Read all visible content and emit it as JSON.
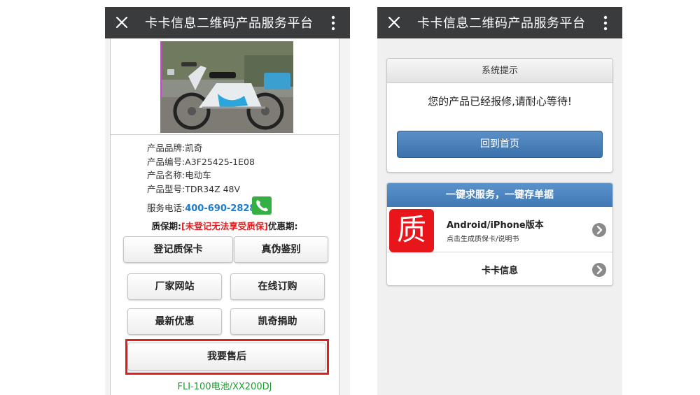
{
  "left_phone": {
    "titlebar": {
      "title": "卡卡信息二维码产品服务平台",
      "close_icon": "close-icon",
      "more_icon": "more-vertical-icon"
    },
    "product_info": {
      "brand": "产品品牌:凯奇",
      "code": "产品编号:A3F25425-1E08",
      "name": "产品名称:电动车",
      "model": "产品型号:TDR34Z 48V",
      "service_label": "服务电话:",
      "service_phone": "400-690-2828"
    },
    "warranty": {
      "label": "质保期:",
      "notice": "[未登记无法享受质保]",
      "promo_label": "优惠期:"
    },
    "buttons": {
      "register": "登记质保卡",
      "verify": "真伪鉴别",
      "website": "厂家网站",
      "order": "在线订购",
      "deals": "最新优惠",
      "donate": "凯奇捐助",
      "after_sales": "我要售后"
    },
    "battery_model": "FLI-100电池/XX200DJ"
  },
  "right_phone": {
    "titlebar": {
      "title": "卡卡信息二维码产品服务平台",
      "close_icon": "close-icon",
      "more_icon": "more-vertical-icon"
    },
    "dialog": {
      "header": "系统提示",
      "message": "您的产品已经报修,请耐心等待!",
      "home_button": "回到首页"
    },
    "service": {
      "header": "一键求服务，一键存单据",
      "app_icon_char": "质",
      "app_title": "Android/iPhone版本",
      "app_subtitle": "点击生成质保卡/说明书",
      "kaka_label": "卡卡信息"
    }
  },
  "colors": {
    "titlebar": "#3a3b3d",
    "link_blue": "#1a7bd0",
    "warning_red": "#e02020",
    "highlight_frame": "#e01f1f",
    "model_green": "#1b9a2e",
    "button_blue": "#3c72ac",
    "app_icon_red": "#e8161b"
  }
}
